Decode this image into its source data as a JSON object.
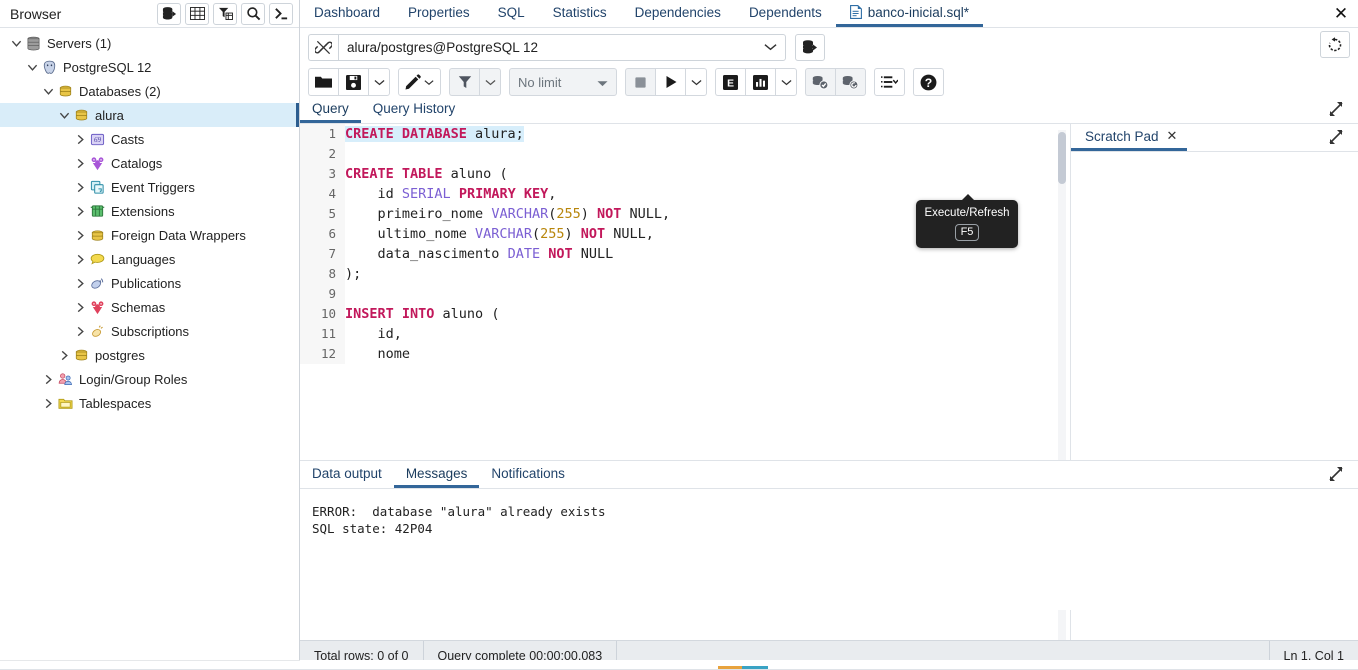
{
  "browser": {
    "title": "Browser",
    "header_buttons": [
      {
        "name": "object-explorer-icon",
        "label": "Object Explorer"
      },
      {
        "name": "grid-icon",
        "label": "Grid View"
      },
      {
        "name": "filter-table-icon",
        "label": "Filtered Rows"
      },
      {
        "name": "search-icon",
        "label": "Search Objects"
      },
      {
        "name": "terminal-icon",
        "label": "PSQL Tool"
      }
    ],
    "tree": [
      {
        "label": "Servers (1)",
        "indent": 0,
        "icon": "servers-icon",
        "expanded": true,
        "selected": false
      },
      {
        "label": "PostgreSQL 12",
        "indent": 1,
        "icon": "postgresql-icon",
        "expanded": true,
        "selected": false
      },
      {
        "label": "Databases (2)",
        "indent": 2,
        "icon": "database-group-icon",
        "expanded": true,
        "selected": false
      },
      {
        "label": "alura",
        "indent": 3,
        "icon": "database-icon",
        "expanded": true,
        "selected": true
      },
      {
        "label": "Casts",
        "indent": 4,
        "icon": "casts-icon",
        "expanded": false,
        "selected": false
      },
      {
        "label": "Catalogs",
        "indent": 4,
        "icon": "catalogs-icon",
        "expanded": false,
        "selected": false
      },
      {
        "label": "Event Triggers",
        "indent": 4,
        "icon": "event-triggers-icon",
        "expanded": false,
        "selected": false
      },
      {
        "label": "Extensions",
        "indent": 4,
        "icon": "extensions-icon",
        "expanded": false,
        "selected": false
      },
      {
        "label": "Foreign Data Wrappers",
        "indent": 4,
        "icon": "foreign-data-wrappers-icon",
        "expanded": false,
        "selected": false
      },
      {
        "label": "Languages",
        "indent": 4,
        "icon": "languages-icon",
        "expanded": false,
        "selected": false
      },
      {
        "label": "Publications",
        "indent": 4,
        "icon": "publications-icon",
        "expanded": false,
        "selected": false
      },
      {
        "label": "Schemas",
        "indent": 4,
        "icon": "schemas-icon",
        "expanded": false,
        "selected": false
      },
      {
        "label": "Subscriptions",
        "indent": 4,
        "icon": "subscriptions-icon",
        "expanded": false,
        "selected": false
      },
      {
        "label": "postgres",
        "indent": 3,
        "icon": "database-icon",
        "expanded": false,
        "selected": false
      },
      {
        "label": "Login/Group Roles",
        "indent": 2,
        "icon": "roles-icon",
        "expanded": false,
        "selected": false
      },
      {
        "label": "Tablespaces",
        "indent": 2,
        "icon": "tablespaces-icon",
        "expanded": false,
        "selected": false
      }
    ]
  },
  "object_tabs": {
    "items": [
      {
        "label": "Dashboard",
        "active": false,
        "icon": null
      },
      {
        "label": "Properties",
        "active": false,
        "icon": null
      },
      {
        "label": "SQL",
        "active": false,
        "icon": null
      },
      {
        "label": "Statistics",
        "active": false,
        "icon": null
      },
      {
        "label": "Dependencies",
        "active": false,
        "icon": null
      },
      {
        "label": "Dependents",
        "active": false,
        "icon": null
      },
      {
        "label": "banco-inicial.sql*",
        "active": true,
        "icon": "sql-file-icon"
      }
    ],
    "close_label": "✕"
  },
  "connection": {
    "value": "alura/postgres@PostgreSQL 12",
    "chain_icon": "connection-chain-icon",
    "caret_icon": "chevron-down-icon",
    "db_button_icon": "database-select-icon",
    "reset_icon": "reset-layout-icon"
  },
  "toolbar": {
    "open_file": {
      "name": "open-file-button",
      "icon": "folder-icon"
    },
    "save_file": {
      "name": "save-file-button",
      "icon": "save-icon"
    },
    "save_caret": {
      "name": "save-options-caret",
      "icon": "chevron-down-icon"
    },
    "edit": {
      "name": "edit-button",
      "icon": "pencil-icon"
    },
    "edit_caret": {
      "name": "edit-options-caret",
      "icon": "chevron-down-icon"
    },
    "filter": {
      "name": "filter-button",
      "icon": "funnel-icon"
    },
    "filter_caret": {
      "name": "filter-options-caret",
      "icon": "chevron-down-icon"
    },
    "limit_label": "No limit",
    "limit_caret": "caret-down-icon",
    "stop": {
      "name": "stop-query-button",
      "icon": "stop-square-icon"
    },
    "execute": {
      "name": "execute-refresh-button",
      "icon": "play-triangle-icon"
    },
    "execute_caret": {
      "name": "execute-options-caret",
      "icon": "chevron-down-icon"
    },
    "explain": {
      "name": "explain-button",
      "icon": "explain-e-icon"
    },
    "explain_analyze": {
      "name": "explain-analyze-button",
      "icon": "bar-chart-icon"
    },
    "explain_caret": {
      "name": "explain-options-caret",
      "icon": "chevron-down-icon"
    },
    "commit": {
      "name": "commit-button",
      "icon": "commit-check-icon"
    },
    "rollback": {
      "name": "rollback-button",
      "icon": "rollback-arrow-icon"
    },
    "macros": {
      "name": "macros-button",
      "icon": "list-icon"
    },
    "macros_caret": {
      "name": "macros-caret",
      "icon": "chevron-down-icon"
    },
    "help": {
      "name": "help-button",
      "icon": "question-mark-icon"
    }
  },
  "tooltip": {
    "text": "Execute/Refresh",
    "shortcut": "F5"
  },
  "query_panel": {
    "tabs": [
      {
        "label": "Query",
        "active": true
      },
      {
        "label": "Query History",
        "active": false
      }
    ],
    "expand_icon": "expand-diagonal-icon",
    "code_lines": [
      {
        "n": "1",
        "selected": true,
        "tokens": [
          {
            "t": "CREATE DATABASE ",
            "c": "kw"
          },
          {
            "t": "alura;",
            "c": "plain"
          }
        ]
      },
      {
        "n": "2",
        "selected": false,
        "tokens": [
          {
            "t": "",
            "c": "plain"
          }
        ]
      },
      {
        "n": "3",
        "selected": false,
        "tokens": [
          {
            "t": "CREATE TABLE ",
            "c": "kw"
          },
          {
            "t": "aluno (",
            "c": "plain"
          }
        ]
      },
      {
        "n": "4",
        "selected": false,
        "tokens": [
          {
            "t": "    id ",
            "c": "plain"
          },
          {
            "t": "SERIAL ",
            "c": "kw2"
          },
          {
            "t": "PRIMARY KEY",
            "c": "kw"
          },
          {
            "t": ",",
            "c": "plain"
          }
        ]
      },
      {
        "n": "5",
        "selected": false,
        "tokens": [
          {
            "t": "    primeiro_nome ",
            "c": "plain"
          },
          {
            "t": "VARCHAR",
            "c": "kw2"
          },
          {
            "t": "(",
            "c": "plain"
          },
          {
            "t": "255",
            "c": "num"
          },
          {
            "t": ") ",
            "c": "plain"
          },
          {
            "t": "NOT ",
            "c": "kw"
          },
          {
            "t": "NULL,",
            "c": "plain"
          }
        ]
      },
      {
        "n": "6",
        "selected": false,
        "tokens": [
          {
            "t": "    ultimo_nome ",
            "c": "plain"
          },
          {
            "t": "VARCHAR",
            "c": "kw2"
          },
          {
            "t": "(",
            "c": "plain"
          },
          {
            "t": "255",
            "c": "num"
          },
          {
            "t": ") ",
            "c": "plain"
          },
          {
            "t": "NOT ",
            "c": "kw"
          },
          {
            "t": "NULL,",
            "c": "plain"
          }
        ]
      },
      {
        "n": "7",
        "selected": false,
        "tokens": [
          {
            "t": "    data_nascimento ",
            "c": "plain"
          },
          {
            "t": "DATE ",
            "c": "kw2"
          },
          {
            "t": "NOT ",
            "c": "kw"
          },
          {
            "t": "NULL",
            "c": "plain"
          }
        ]
      },
      {
        "n": "8",
        "selected": false,
        "tokens": [
          {
            "t": ");",
            "c": "plain"
          }
        ]
      },
      {
        "n": "9",
        "selected": false,
        "tokens": [
          {
            "t": "",
            "c": "plain"
          }
        ]
      },
      {
        "n": "10",
        "selected": false,
        "tokens": [
          {
            "t": "INSERT INTO ",
            "c": "kw"
          },
          {
            "t": "aluno (",
            "c": "plain"
          }
        ]
      },
      {
        "n": "11",
        "selected": false,
        "tokens": [
          {
            "t": "    id,",
            "c": "plain"
          }
        ]
      },
      {
        "n": "12",
        "selected": false,
        "tokens": [
          {
            "t": "    nome",
            "c": "plain"
          }
        ]
      }
    ]
  },
  "scratch_pad": {
    "tab_label": "Scratch Pad",
    "close_label": "✕",
    "expand_icon": "expand-diagonal-icon",
    "content": ""
  },
  "output_panel": {
    "tabs": [
      {
        "label": "Data output",
        "active": false
      },
      {
        "label": "Messages",
        "active": true
      },
      {
        "label": "Notifications",
        "active": false
      }
    ],
    "expand_icon": "expand-diagonal-icon",
    "messages": "ERROR:  database \"alura\" already exists\nSQL state: 42P04"
  },
  "status_bar": {
    "total_rows": "Total rows: 0 of 0",
    "query_status": "Query complete 00:00:00.083",
    "cursor_position": "Ln 1, Col 1"
  },
  "colors": {
    "accent": "#336699",
    "selection": "#d9edf9",
    "keyword": "#c2185b",
    "type": "#7b5fd3",
    "number": "#b8860b",
    "statusbar_bg": "#e9ecef"
  }
}
